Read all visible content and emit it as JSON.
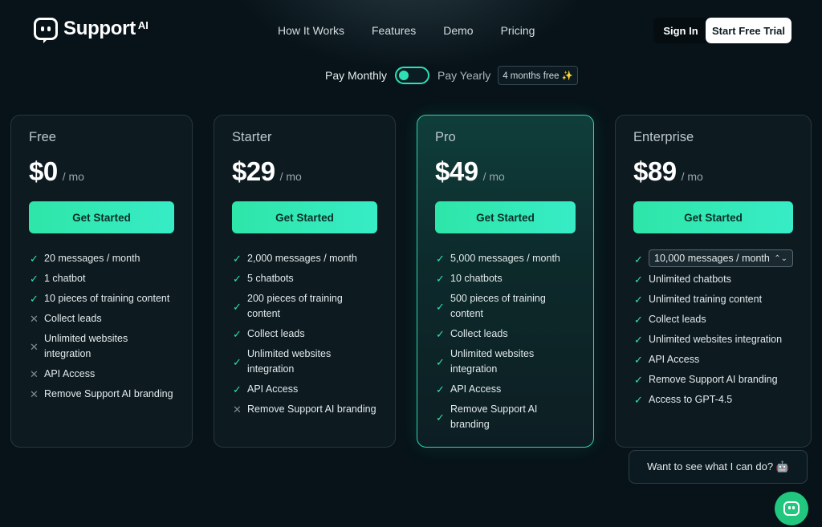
{
  "brand": {
    "name": "Support",
    "suffix": "AI"
  },
  "nav": {
    "items": [
      "How It Works",
      "Features",
      "Demo",
      "Pricing"
    ]
  },
  "header": {
    "signin": "Sign In",
    "trial": "Start Free Trial"
  },
  "billing": {
    "monthly": "Pay Monthly",
    "yearly": "Pay Yearly",
    "badge": "4 months free ✨",
    "selected": "monthly"
  },
  "colors": {
    "accent": "#2fe0b4",
    "background": "#071319",
    "card": "#0d1b21",
    "cta": "#2ee6a8",
    "chat": "#22c77f"
  },
  "plans": [
    {
      "name": "Free",
      "price": "$0",
      "per": "/ mo",
      "cta": "Get Started",
      "features": [
        {
          "text": "20 messages / month",
          "included": true
        },
        {
          "text": "1 chatbot",
          "included": true
        },
        {
          "text": "10 pieces of training content",
          "included": true
        },
        {
          "text": "Collect leads",
          "included": false
        },
        {
          "text": "Unlimited websites integration",
          "included": false
        },
        {
          "text": "API Access",
          "included": false
        },
        {
          "text": "Remove Support AI branding",
          "included": false
        }
      ]
    },
    {
      "name": "Starter",
      "price": "$29",
      "per": "/ mo",
      "cta": "Get Started",
      "features": [
        {
          "text": "2,000 messages / month",
          "included": true
        },
        {
          "text": "5 chatbots",
          "included": true
        },
        {
          "text": "200 pieces of training content",
          "included": true
        },
        {
          "text": "Collect leads",
          "included": true
        },
        {
          "text": "Unlimited websites integration",
          "included": true
        },
        {
          "text": "API Access",
          "included": true
        },
        {
          "text": "Remove Support AI branding",
          "included": false
        }
      ]
    },
    {
      "name": "Pro",
      "price": "$49",
      "per": "/ mo",
      "cta": "Get Started",
      "features": [
        {
          "text": "5,000 messages / month",
          "included": true
        },
        {
          "text": "10 chatbots",
          "included": true
        },
        {
          "text": "500 pieces of training content",
          "included": true
        },
        {
          "text": "Collect leads",
          "included": true
        },
        {
          "text": "Unlimited websites integration",
          "included": true
        },
        {
          "text": "API Access",
          "included": true
        },
        {
          "text": "Remove Support AI branding",
          "included": true
        }
      ]
    },
    {
      "name": "Enterprise",
      "price": "$89",
      "per": "/ mo",
      "cta": "Get Started",
      "features": [
        {
          "text": "10,000 messages / month",
          "included": true,
          "select": true
        },
        {
          "text": "Unlimited chatbots",
          "included": true
        },
        {
          "text": "Unlimited training content",
          "included": true
        },
        {
          "text": "Collect leads",
          "included": true
        },
        {
          "text": "Unlimited websites integration",
          "included": true
        },
        {
          "text": "API Access",
          "included": true
        },
        {
          "text": "Remove Support AI branding",
          "included": true
        },
        {
          "text": "Access to GPT-4.5",
          "included": true
        }
      ]
    }
  ],
  "chat": {
    "prompt": "Want to see what I can do? 🤖"
  }
}
